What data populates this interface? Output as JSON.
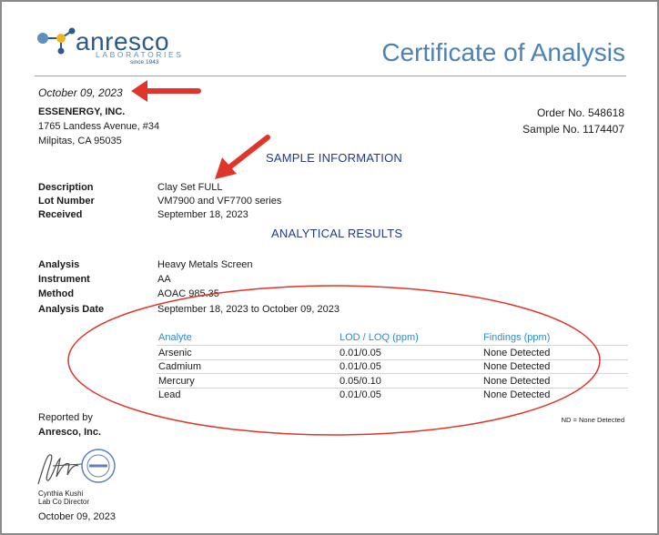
{
  "logo": {
    "name": "anresco",
    "subtitle": "LABORATORIES",
    "since": "since 1943"
  },
  "title": "Certificate of Analysis",
  "date_top": "October 09, 2023",
  "client": {
    "name": "ESSENERGY, INC.",
    "address1": "1765 Landess Avenue, #34",
    "address2": "Milpitas, CA 95035"
  },
  "order": {
    "order_no": "Order No. 548618",
    "sample_no": "Sample No. 1174407"
  },
  "sample_section": "SAMPLE INFORMATION",
  "sample": {
    "description_label": "Description",
    "description_value": "Clay Set FULL",
    "lot_label": "Lot Number",
    "lot_value": "VM7900 and VF7700 series",
    "received_label": "Received",
    "received_value": "September 18, 2023"
  },
  "results_section": "ANALYTICAL RESULTS",
  "analysis": {
    "analysis_label": "Analysis",
    "analysis_value": "Heavy Metals Screen",
    "instrument_label": "Instrument",
    "instrument_value": "AA",
    "method_label": "Method",
    "method_value": "AOAC 985.35",
    "date_label": "Analysis Date",
    "date_value": "September 18, 2023 to October 09, 2023"
  },
  "table": {
    "headers": [
      "Analyte",
      "LOD / LOQ (ppm)",
      "Findings (ppm)"
    ],
    "rows": [
      [
        "Arsenic",
        "0.01/0.05",
        "None Detected"
      ],
      [
        "Cadmium",
        "0.01/0.05",
        "None Detected"
      ],
      [
        "Mercury",
        "0.05/0.10",
        "None Detected"
      ],
      [
        "Lead",
        "0.01/0.05",
        "None Detected"
      ]
    ],
    "note": "ND = None Detected"
  },
  "reported": {
    "label": "Reported by",
    "company": "Anresco, Inc."
  },
  "signer": {
    "name": "Cynthia Kushi",
    "title": "Lab Co Director",
    "date": "October 09, 2023"
  },
  "colors": {
    "brand_blue": "#2a5a8c",
    "title_blue": "#4a82b8",
    "section_navy": "#1f3a8a",
    "table_header": "#2b8bd0",
    "annotation_red": "#e0352b"
  }
}
